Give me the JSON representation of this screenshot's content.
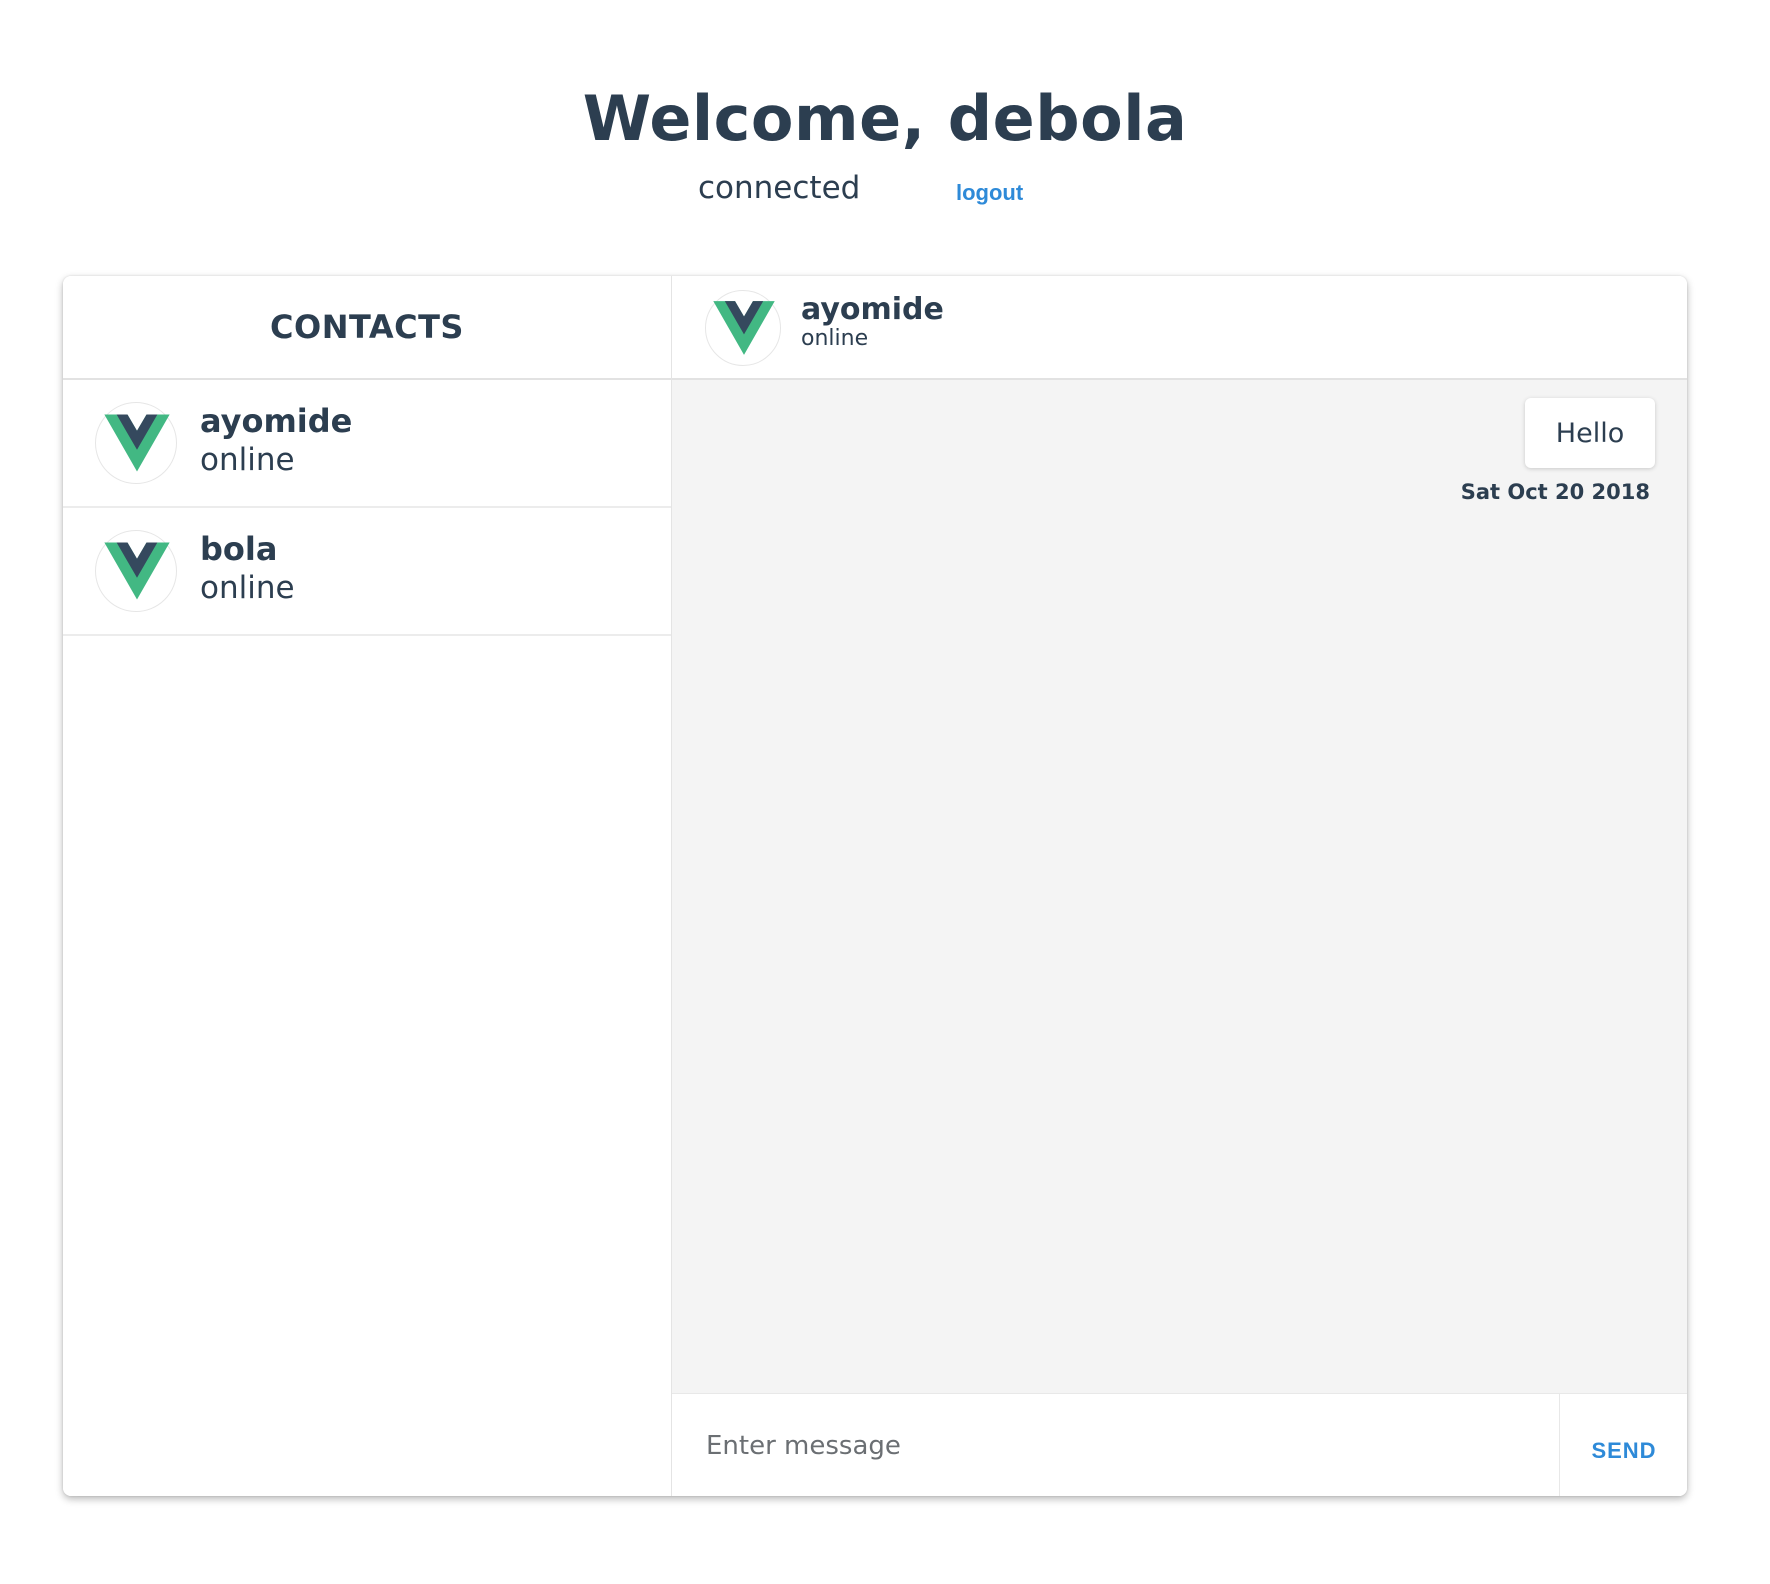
{
  "header": {
    "welcome": "Welcome, debola",
    "connection_status": "connected",
    "logout_label": "logout"
  },
  "contacts": {
    "title": "CONTACTS",
    "items": [
      {
        "name": "ayomide",
        "status": "online"
      },
      {
        "name": "bola",
        "status": "online"
      }
    ]
  },
  "conversation": {
    "name": "ayomide",
    "status": "online",
    "messages": [
      {
        "text": "Hello",
        "date": "Sat Oct 20 2018"
      }
    ]
  },
  "composer": {
    "placeholder": "Enter message",
    "send_label": "SEND"
  },
  "colors": {
    "text": "#2c3e50",
    "accent": "#2e8ad8",
    "avatar_green": "#42b883",
    "avatar_dark": "#35495e",
    "pane_bg": "#f4f4f4"
  },
  "icons": {
    "avatar": "vue-logo-icon"
  }
}
